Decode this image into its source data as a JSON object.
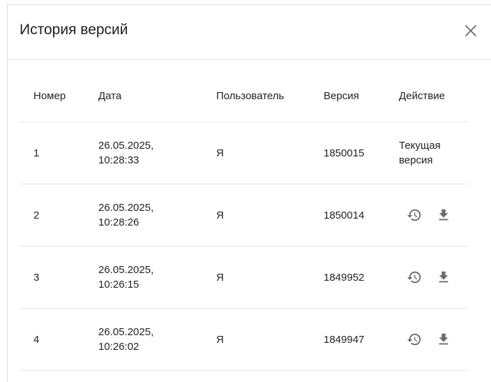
{
  "dialog": {
    "title": "История версий",
    "close_icon": "close-icon"
  },
  "table": {
    "columns": [
      "Номер",
      "Дата",
      "Пользователь",
      "Версия",
      "Действие"
    ],
    "rows": [
      {
        "number": "1",
        "date": "26.05.2025,\n10:28:33",
        "user": "Я",
        "version": "1850015",
        "action": "Текущая\nверсия"
      },
      {
        "number": "2",
        "date": "26.05.2025,\n10:28:26",
        "user": "Я",
        "version": "1850014",
        "actions": [
          "restore-icon",
          "download-icon"
        ]
      },
      {
        "number": "3",
        "date": "26.05.2025,\n10:26:15",
        "user": "Я",
        "version": "1849952",
        "actions": [
          "restore-icon",
          "download-icon"
        ]
      },
      {
        "number": "4",
        "date": "26.05.2025,\n10:26:02",
        "user": "Я",
        "version": "1849947",
        "actions": [
          "restore-icon",
          "download-icon"
        ]
      }
    ]
  },
  "colors": {
    "icon": "#6b6b6b",
    "divider": "#e8e8e8",
    "text": "#222222"
  }
}
